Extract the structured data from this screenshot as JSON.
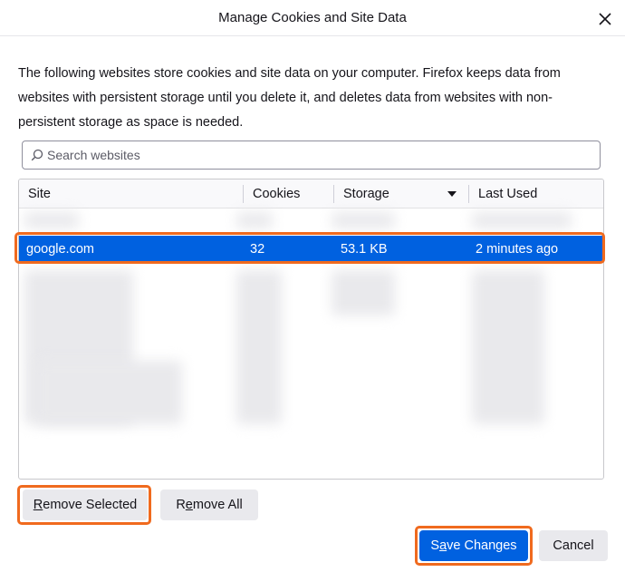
{
  "dialog": {
    "title": "Manage Cookies and Site Data",
    "description": "The following websites store cookies and site data on your computer. Firefox keeps data from websites with persistent storage until you delete it, and deletes data from websites with non-persistent storage as space is needed."
  },
  "search": {
    "placeholder": "Search websites",
    "value": ""
  },
  "table": {
    "columns": [
      {
        "label": "Site"
      },
      {
        "label": "Cookies"
      },
      {
        "label": "Storage"
      },
      {
        "label": "Last Used"
      }
    ],
    "sorted_column": "Storage",
    "selected_row": {
      "site": "google.com",
      "cookies": "32",
      "storage": "53.1 KB",
      "last_used": "2 minutes ago"
    }
  },
  "buttons": {
    "remove_selected": {
      "access": "R",
      "rest": "emove Selected"
    },
    "remove_all": {
      "pre": "R",
      "access": "e",
      "rest": "move All"
    },
    "save_changes": {
      "pre": "S",
      "access": "a",
      "rest": "ve Changes"
    },
    "cancel": "Cancel"
  },
  "colors": {
    "accent": "#0061e0",
    "highlight": "#f06a1e"
  }
}
